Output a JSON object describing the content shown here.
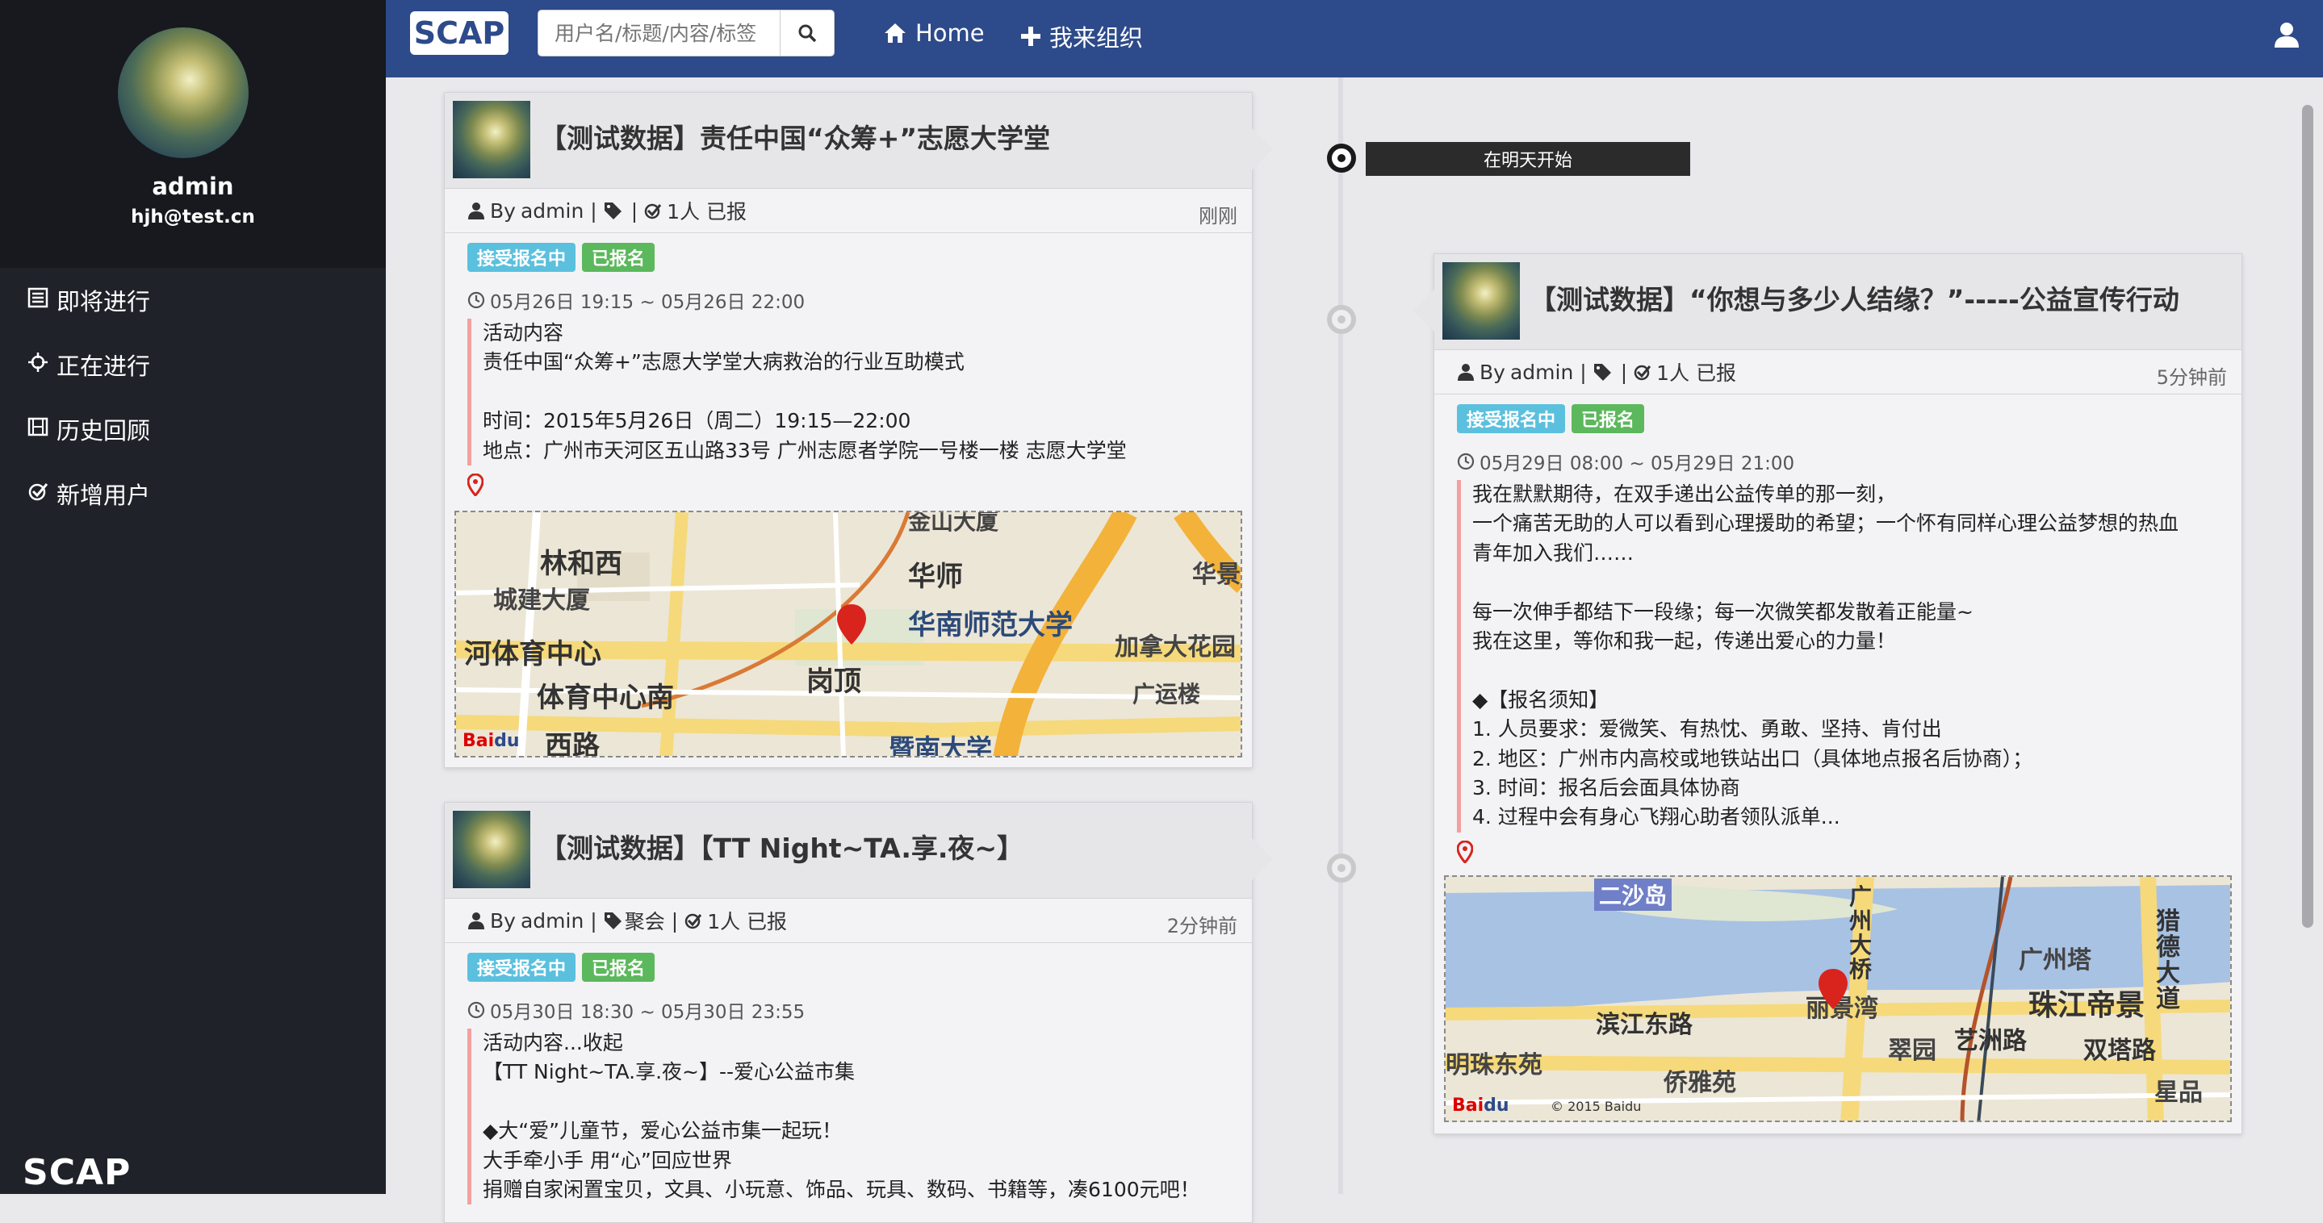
{
  "sidebar": {
    "username": "admin",
    "email": "hjh@test.cn",
    "menu": [
      {
        "label": "即将进行",
        "icon": "list-icon"
      },
      {
        "label": "正在进行",
        "icon": "crosshair-icon"
      },
      {
        "label": "历史回顾",
        "icon": "film-icon"
      },
      {
        "label": "新增用户",
        "icon": "check-circle-icon"
      }
    ],
    "brand": "SCAP"
  },
  "topbar": {
    "logo": "SCAP",
    "search_placeholder": "用户名/标题/内容/标签",
    "home": "Home",
    "organize": "我来组织"
  },
  "timeline": {
    "badge": "在明天开始"
  },
  "cards": [
    {
      "title": "【测试数据】责任中国“众筹+”志愿大学堂",
      "author_prefix": "By",
      "author": "admin",
      "tag_text": "",
      "participants": "1人 已报",
      "ago": "刚刚",
      "badge_open": "接受报名中",
      "badge_joined": "已报名",
      "time": "05月26日 19:15 ~ 05月26日 22:00",
      "desc": [
        "活动内容",
        "责任中国“众筹+”志愿大学堂大病救治的行业互助模式",
        "",
        "时间：2015年5月26日（周二）19:15—22:00",
        "地点：广州市天河区五山路33号 广州志愿者学院一号楼一楼 志愿大学堂"
      ],
      "map_labels": [
        "林和西",
        "城建大厦",
        "河体育中心",
        "体育中心南",
        "西路",
        "华师",
        "华南师范大学",
        "岗顶",
        "加拿大花园",
        "广运楼",
        "华景",
        "暨南大学",
        "金山大厦"
      ]
    },
    {
      "title": "【测试数据】“你想与多少人结缘？”-----公益宣传行动",
      "author_prefix": "By",
      "author": "admin",
      "tag_text": "",
      "participants": "1人 已报",
      "ago": "5分钟前",
      "badge_open": "接受报名中",
      "badge_joined": "已报名",
      "time": "05月29日 08:00 ~ 05月29日 21:00",
      "desc": [
        "我在默默期待，在双手递出公益传单的那一刻，",
        "一个痛苦无助的人可以看到心理援助的希望；一个怀有同样心理公益梦想的热血",
        "青年加入我们……",
        "",
        "每一次伸手都结下一段缘；每一次微笑都发散着正能量~",
        "我在这里，等你和我一起，传递出爱心的力量！",
        "",
        "◆【报名须知】",
        "1. 人员要求：爱微笑、有热忱、勇敢、坚持、肯付出",
        "2. 地区：广州市内高校或地铁站出口（具体地点报名后协商）；",
        "3. 时间：报名后会面具体协商",
        "4. 过程中会有身心飞翔心助者领队派单..."
      ],
      "map_labels": [
        "二沙岛",
        "广州大桥",
        "广州塔",
        "猎德大道",
        "珠江帝景",
        "滨江东路",
        "丽景湾",
        "艺洲路",
        "明珠东苑",
        "翠园",
        "双塔路",
        "侨雅苑",
        "星品"
      ],
      "map_copyright": "© 2015 Baidu"
    },
    {
      "title": "【测试数据】【TT Night~TA.享.夜~】",
      "author_prefix": "By",
      "author": "admin",
      "tag_text": "聚会",
      "participants": "1人 已报",
      "ago": "2分钟前",
      "badge_open": "接受报名中",
      "badge_joined": "已报名",
      "time": "05月30日 18:30 ~ 05月30日 23:55",
      "desc": [
        "活动内容...收起",
        "【TT Night~TA.享.夜~】--爱心公益市集",
        "",
        "◆大“爱”儿童节，爱心公益市集一起玩！",
        "大手牵小手 用“心”回应世界",
        "捐赠自家闲置宝贝，文具、小玩意、饰品、玩具、数码、书籍等，凑6100元吧！"
      ]
    }
  ],
  "colors": {
    "sidebar_bg": "#1f2229",
    "topbar_bg": "#2d4a8a",
    "badge_blue": "#5bc0de",
    "badge_green": "#5cb85c",
    "desc_border": "#f2a0a0"
  }
}
